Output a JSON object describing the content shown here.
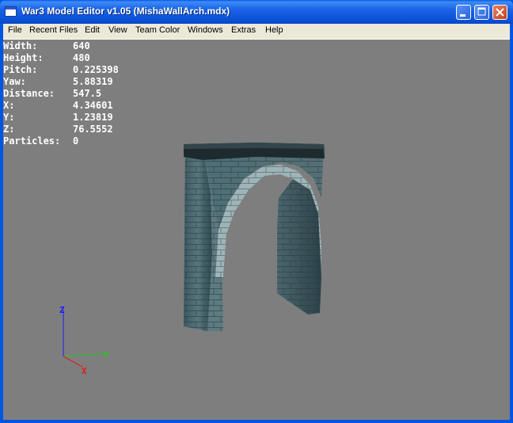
{
  "window": {
    "title": "War3 Model Editor v1.05 (MishaWallArch.mdx)",
    "icons": {
      "app": "app-window-icon",
      "minimize": "minimize-icon",
      "maximize": "maximize-icon",
      "close": "close-icon"
    }
  },
  "menu": {
    "file": "File",
    "recent_files": "Recent Files",
    "edit": "Edit",
    "view": "View",
    "team_color": "Team Color",
    "windows": "Windows",
    "extras": "Extras",
    "help": "Help"
  },
  "viewport": {
    "background_color": "#7e7e7e",
    "stats": [
      {
        "label": "Width:",
        "value": "640"
      },
      {
        "label": "Height:",
        "value": "480"
      },
      {
        "label": "Pitch:",
        "value": "0.225398"
      },
      {
        "label": "Yaw:",
        "value": "5.88319"
      },
      {
        "label": "Distance:",
        "value": "547.5"
      },
      {
        "label": "X:",
        "value": "4.34601"
      },
      {
        "label": "Y:",
        "value": "1.23819"
      },
      {
        "label": "Z:",
        "value": "76.5552"
      },
      {
        "label": "Particles:",
        "value": "0"
      }
    ],
    "axes": {
      "z": {
        "label": "Z",
        "color": "#1a1aff"
      },
      "y": {
        "label": "Y",
        "color": "#1ec81e"
      },
      "x": {
        "label": "X",
        "color": "#e01a1a"
      }
    }
  }
}
